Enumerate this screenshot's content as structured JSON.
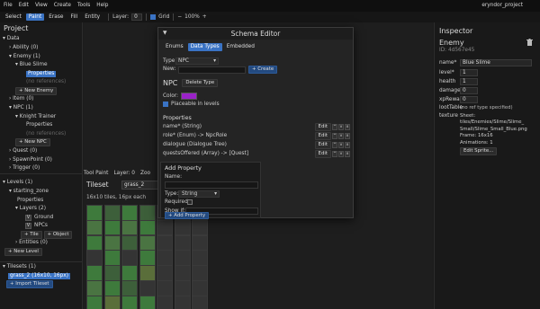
{
  "menubar": {
    "items": [
      "File",
      "Edit",
      "View",
      "Create",
      "Tools",
      "Help"
    ],
    "project": "eryndor_project"
  },
  "toolbar": {
    "tools": [
      "Select",
      "Paint",
      "Erase",
      "Fill",
      "Entity"
    ],
    "active_tool": "Paint",
    "layer_label": "Layer:",
    "layer_value": "0",
    "grid_label": "Grid",
    "grid_checked": true,
    "zoom_minus": "−",
    "zoom": "100%",
    "zoom_plus": "+"
  },
  "project_panel": {
    "title": "Project",
    "data_label": "Data",
    "ability": "Ability (0)",
    "enemy": "Enemy (1)",
    "blue_slime": "Blue Slime",
    "properties": "Properties",
    "no_references": "(no references)",
    "new_enemy": "+ New Enemy",
    "item": "Item (0)",
    "npc": "NPC (1)",
    "knight_trainer": "Knight Trainer",
    "npc_properties": "Properties",
    "npc_no_references": "(no references)",
    "new_npc": "+ New NPC",
    "quest": "Quest (0)",
    "spawnpoint": "SpawnPoint (0)",
    "trigger": "Trigger (0)",
    "levels": "Levels (1)",
    "starting_zone": "starting_zone",
    "level_properties": "Properties",
    "layers": "Layers (2)",
    "ground": "Ground",
    "npcs": "NPCs",
    "add_tile": "+ Tile",
    "add_object": "+ Object",
    "entities": "Entities (0)",
    "new_level": "+ New Level",
    "tilesets": "Tilesets (1)",
    "tileset_item": "grass_2 (16x10, 16px)",
    "import_tileset": "+ Import Tileset"
  },
  "tile_panel": {
    "tabs": [
      "Tool Paint",
      "Layer: 0",
      "Zoo"
    ],
    "title": "Tileset",
    "selected": "grass_2",
    "info": "16x10 tiles, 16px each"
  },
  "schema_editor": {
    "title": "Schema Editor",
    "collapse_icon": "▼",
    "tabs": [
      "Enums",
      "Data Types",
      "Embedded"
    ],
    "active_tab": "Data Types",
    "type_label": "Type:",
    "type_value": "NPC",
    "new_label": "New:",
    "create_button": "+ Create",
    "section_title": "NPC",
    "delete_button": "Delete Type",
    "color_label": "Color:",
    "color_value": "#9a22c8",
    "placeable_label": "Placeable in levels",
    "placeable_checked": true,
    "properties_title": "Properties",
    "properties": [
      {
        "text": "name* (String)",
        "edit": "Edit"
      },
      {
        "text": "role* (Enum)  -> NpcRole",
        "edit": "Edit"
      },
      {
        "text": "dialogue (Dialogue Tree)",
        "edit": "Edit"
      },
      {
        "text": "questsOffered (Array)  -> [Quest]",
        "edit": "Edit"
      }
    ],
    "up_icon": "^",
    "down_icon": "v",
    "remove_icon": "x",
    "add_property": {
      "title": "Add Property",
      "name_label": "Name:",
      "type_label": "Type:",
      "type_value": "String",
      "required_label": "Required:",
      "show_if_label": "Show if:",
      "add_button": "+ Add Property"
    }
  },
  "inspector": {
    "title": "Inspector",
    "entity_type": "Enemy",
    "entity_id": "ID: 4d567e45",
    "fields": [
      {
        "key": "name*",
        "value": "Blue Slime"
      },
      {
        "key": "level*",
        "value": "1"
      },
      {
        "key": "health",
        "value": "1"
      },
      {
        "key": "damage",
        "value": "0"
      },
      {
        "key": "xpReward",
        "value": "0"
      },
      {
        "key": "lootTable",
        "value": "(no ref type specified)"
      }
    ],
    "texture_label": "texture",
    "texture_lines": [
      "Sheet:",
      "tiles/Enemies/Slime/Slime_",
      "Small/Slime_Small_Blue.png",
      "Frame: 16x16",
      "Animations: 1"
    ],
    "edit_sprite_button": "Edit Sprite..."
  }
}
